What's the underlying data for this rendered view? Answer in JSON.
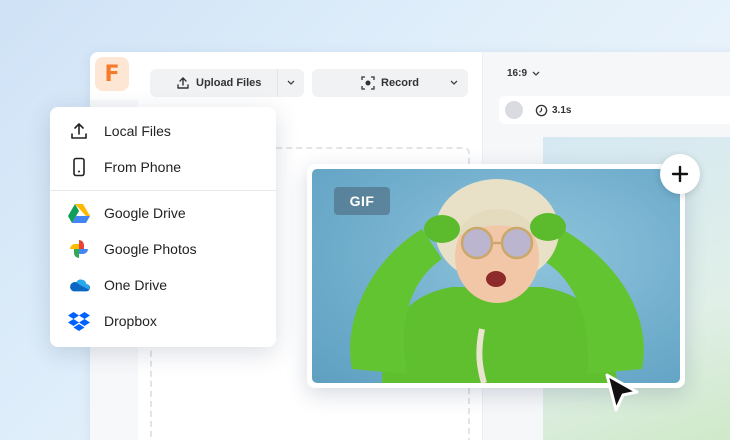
{
  "app": {
    "logo_letter": "F"
  },
  "toolbar": {
    "upload_label": "Upload Files",
    "record_label": "Record"
  },
  "preview": {
    "aspect_ratio": "16:9",
    "duration": "3.1s"
  },
  "upload_menu": {
    "items": [
      {
        "label": "Local Files",
        "icon": "upload-icon"
      },
      {
        "label": "From Phone",
        "icon": "phone-icon"
      },
      {
        "label": "Google Drive",
        "icon": "google-drive-icon"
      },
      {
        "label": "Google Photos",
        "icon": "google-photos-icon"
      },
      {
        "label": "One Drive",
        "icon": "onedrive-icon"
      },
      {
        "label": "Dropbox",
        "icon": "dropbox-icon"
      }
    ]
  },
  "media_card": {
    "badge": "GIF"
  },
  "colors": {
    "brand": "#f57a2a",
    "jacket": "#5fbf2e",
    "photo_bg": "#6fadcc"
  }
}
